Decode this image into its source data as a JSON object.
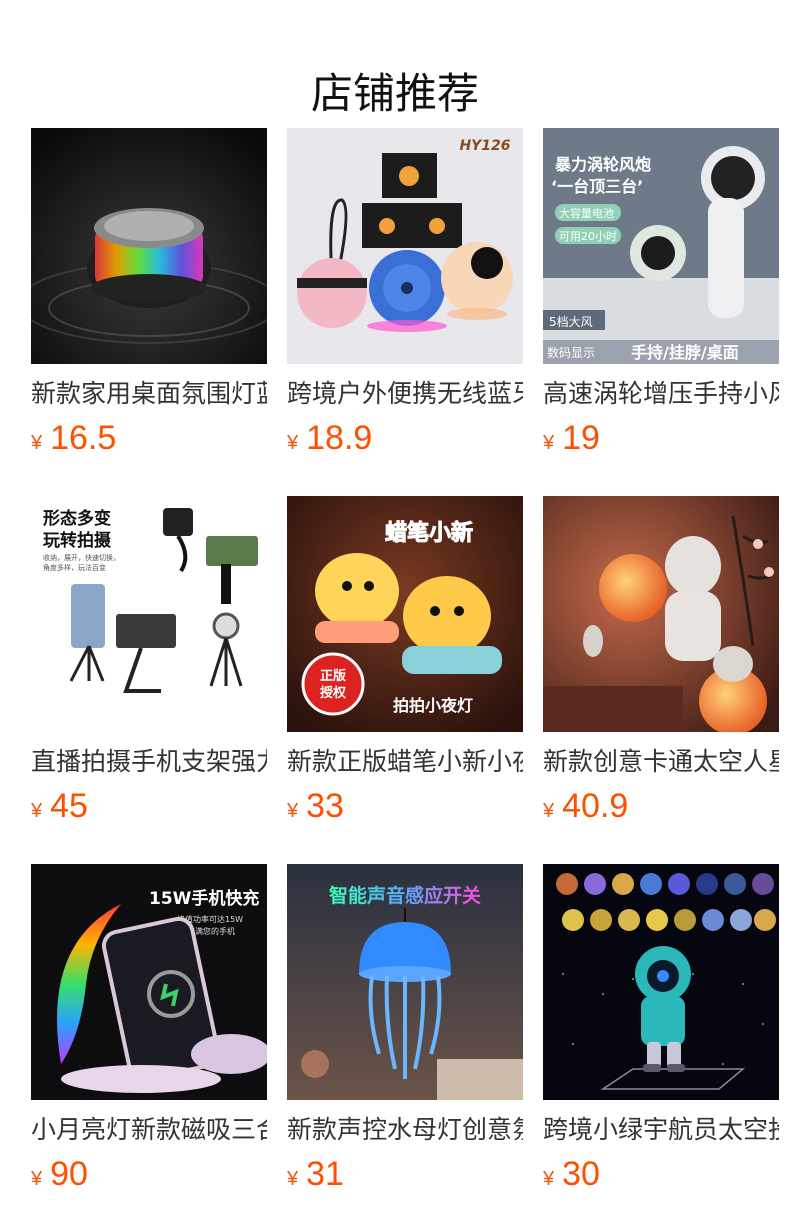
{
  "header": {
    "title": "店铺推荐"
  },
  "products": [
    {
      "name": "新款家用桌面氛围灯蓝牙音箱",
      "currency": "¥",
      "price": "16.5",
      "image_icon": "glowing-speaker-image",
      "image_text": []
    },
    {
      "name": "跨境户外便携无线蓝牙音箱",
      "currency": "¥",
      "price": "18.9",
      "image_icon": "portable-speakers-image",
      "image_text": [
        "HY126"
      ]
    },
    {
      "name": "高速涡轮增压手持小风扇",
      "currency": "¥",
      "price": "19",
      "image_icon": "handheld-fan-image",
      "image_text": [
        "暴力涡轮风炮",
        "‘一台顶三台’",
        "大容量电池",
        "可用20小时",
        "5档大风",
        "数码显示",
        "手持/挂脖/桌面"
      ]
    },
    {
      "name": "直播拍摄手机支架强力磁吸",
      "currency": "¥",
      "price": "45",
      "image_icon": "phone-stand-image",
      "image_text": [
        "形态多变",
        "玩转拍摄",
        "收纳，展开，快速切换，",
        "角度多样，玩法百变"
      ]
    },
    {
      "name": "新款正版蜡笔小新小夜灯",
      "currency": "¥",
      "price": "33",
      "image_icon": "crayon-shinchan-lamp-image",
      "image_text": [
        "蜡笔小新",
        "正版",
        "授权",
        "拍拍小夜灯"
      ]
    },
    {
      "name": "新款创意卡通太空人星球灯",
      "currency": "¥",
      "price": "40.9",
      "image_icon": "astronaut-moon-lamp-image",
      "image_text": []
    },
    {
      "name": "小月亮灯新款磁吸三合一无线充",
      "currency": "¥",
      "price": "90",
      "image_icon": "moon-wireless-charger-image",
      "image_text": [
        "15W手机快充",
        "峰值功率可达15W",
        "快速充满您的手机"
      ]
    },
    {
      "name": "新款声控水母灯创意氛围灯",
      "currency": "¥",
      "price": "31",
      "image_icon": "jellyfish-lamp-image",
      "image_text": [
        "智能声音感应开关"
      ]
    },
    {
      "name": "跨境小绿宇航员太空投影灯",
      "currency": "¥",
      "price": "30",
      "image_icon": "astronaut-projector-image",
      "image_text": []
    }
  ],
  "colors": {
    "price": "#ff5000",
    "title": "#111111",
    "name": "#333333"
  }
}
